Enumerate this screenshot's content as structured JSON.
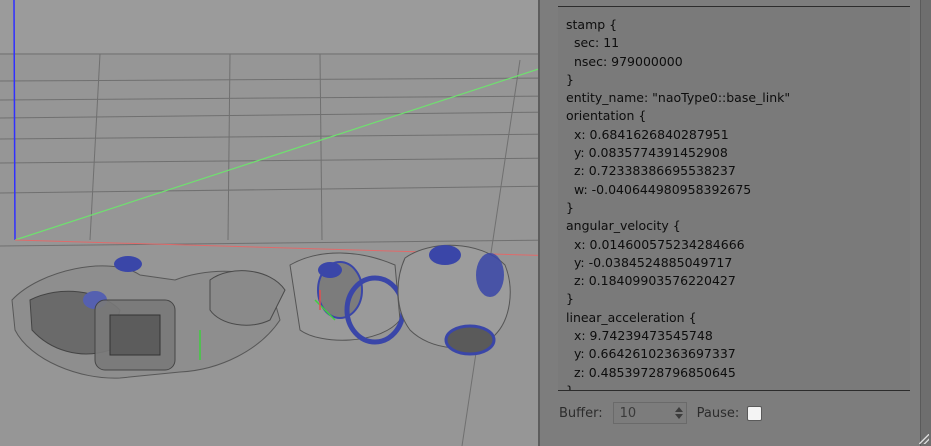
{
  "viewport": {
    "label": "3D simulation view",
    "colors": {
      "background": "#969696",
      "grid": "#6f6f6f",
      "axis_x": "#e06060",
      "axis_y": "#6fe06f",
      "axis_z": "#3030ff",
      "robot_body": "#8c8c8c",
      "robot_accent": "#3a46a8"
    }
  },
  "panel": {
    "message_lines": [
      "stamp {",
      "  sec: 11",
      "  nsec: 979000000",
      "}",
      "entity_name: \"naoType0::base_link\"",
      "orientation {",
      "  x: 0.6841626840287951",
      "  y: 0.0835774391452908",
      "  z: 0.72338386695538237",
      "  w: -0.040644980958392675",
      "}",
      "angular_velocity {",
      "  x: 0.014600575234284666",
      "  y: -0.0384524885049717",
      "  z: 0.18409903576220427",
      "}",
      "linear_acceleration {",
      "  x: 9.74239473545748",
      "  y: 0.66426102363697337",
      "  z: 0.48539728796850645",
      "}"
    ],
    "buffer_label": "Buffer:",
    "buffer_value": "10",
    "pause_label": "Pause:",
    "pause_checked": false
  }
}
